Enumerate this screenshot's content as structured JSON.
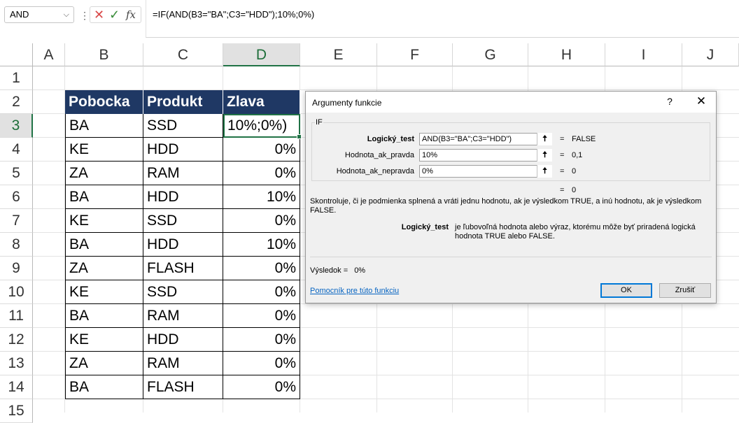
{
  "formula_bar": {
    "name_box": "AND",
    "formula": "=IF(AND(B3=\"BA\";C3=\"HDD\");10%;0%)"
  },
  "columns": [
    "A",
    "B",
    "C",
    "D",
    "E",
    "F",
    "G",
    "H",
    "I",
    "J"
  ],
  "rows": [
    "1",
    "2",
    "3",
    "4",
    "5",
    "6",
    "7",
    "8",
    "9",
    "10",
    "11",
    "12",
    "13",
    "14",
    "15"
  ],
  "table": {
    "headers": [
      "Pobocka",
      "Produkt",
      "Zlava"
    ],
    "rows": [
      [
        "BA",
        "SSD",
        "10%;0%)"
      ],
      [
        "KE",
        "HDD",
        "0%"
      ],
      [
        "ZA",
        "RAM",
        "0%"
      ],
      [
        "BA",
        "HDD",
        "10%"
      ],
      [
        "KE",
        "SSD",
        "0%"
      ],
      [
        "BA",
        "HDD",
        "10%"
      ],
      [
        "ZA",
        "FLASH",
        "0%"
      ],
      [
        "KE",
        "SSD",
        "0%"
      ],
      [
        "BA",
        "RAM",
        "0%"
      ],
      [
        "KE",
        "HDD",
        "0%"
      ],
      [
        "ZA",
        "RAM",
        "0%"
      ],
      [
        "BA",
        "FLASH",
        "0%"
      ]
    ]
  },
  "dialog": {
    "title": "Argumenty funkcie",
    "help": "?",
    "close": "✕",
    "function_name": "IF",
    "args": [
      {
        "label": "Logický_test",
        "value": "AND(B3=\"BA\";C3=\"HDD\")",
        "eq": "=",
        "result": "FALSE"
      },
      {
        "label": "Hodnota_ak_pravda",
        "value": "10%",
        "eq": "=",
        "result": "0,1"
      },
      {
        "label": "Hodnota_ak_nepravda",
        "value": "0%",
        "eq": "=",
        "result": "0"
      }
    ],
    "formula_result_eq": "=",
    "formula_result": "0",
    "description": "Skontroluje, či je podmienka splnená a vráti jednu hodnotu, ak je výsledkom TRUE, a inú hodnotu, ak je výsledkom FALSE.",
    "arg_desc_label": "Logický_test",
    "arg_desc_text": "je ľubovoľná hodnota alebo výraz, ktorému môže byť priradená logická hodnota TRUE alebo FALSE.",
    "result_label": "Výsledok =",
    "result_value": "0%",
    "help_link": "Pomocník pre túto funkciu",
    "ok": "OK",
    "cancel": "Zrušiť"
  }
}
